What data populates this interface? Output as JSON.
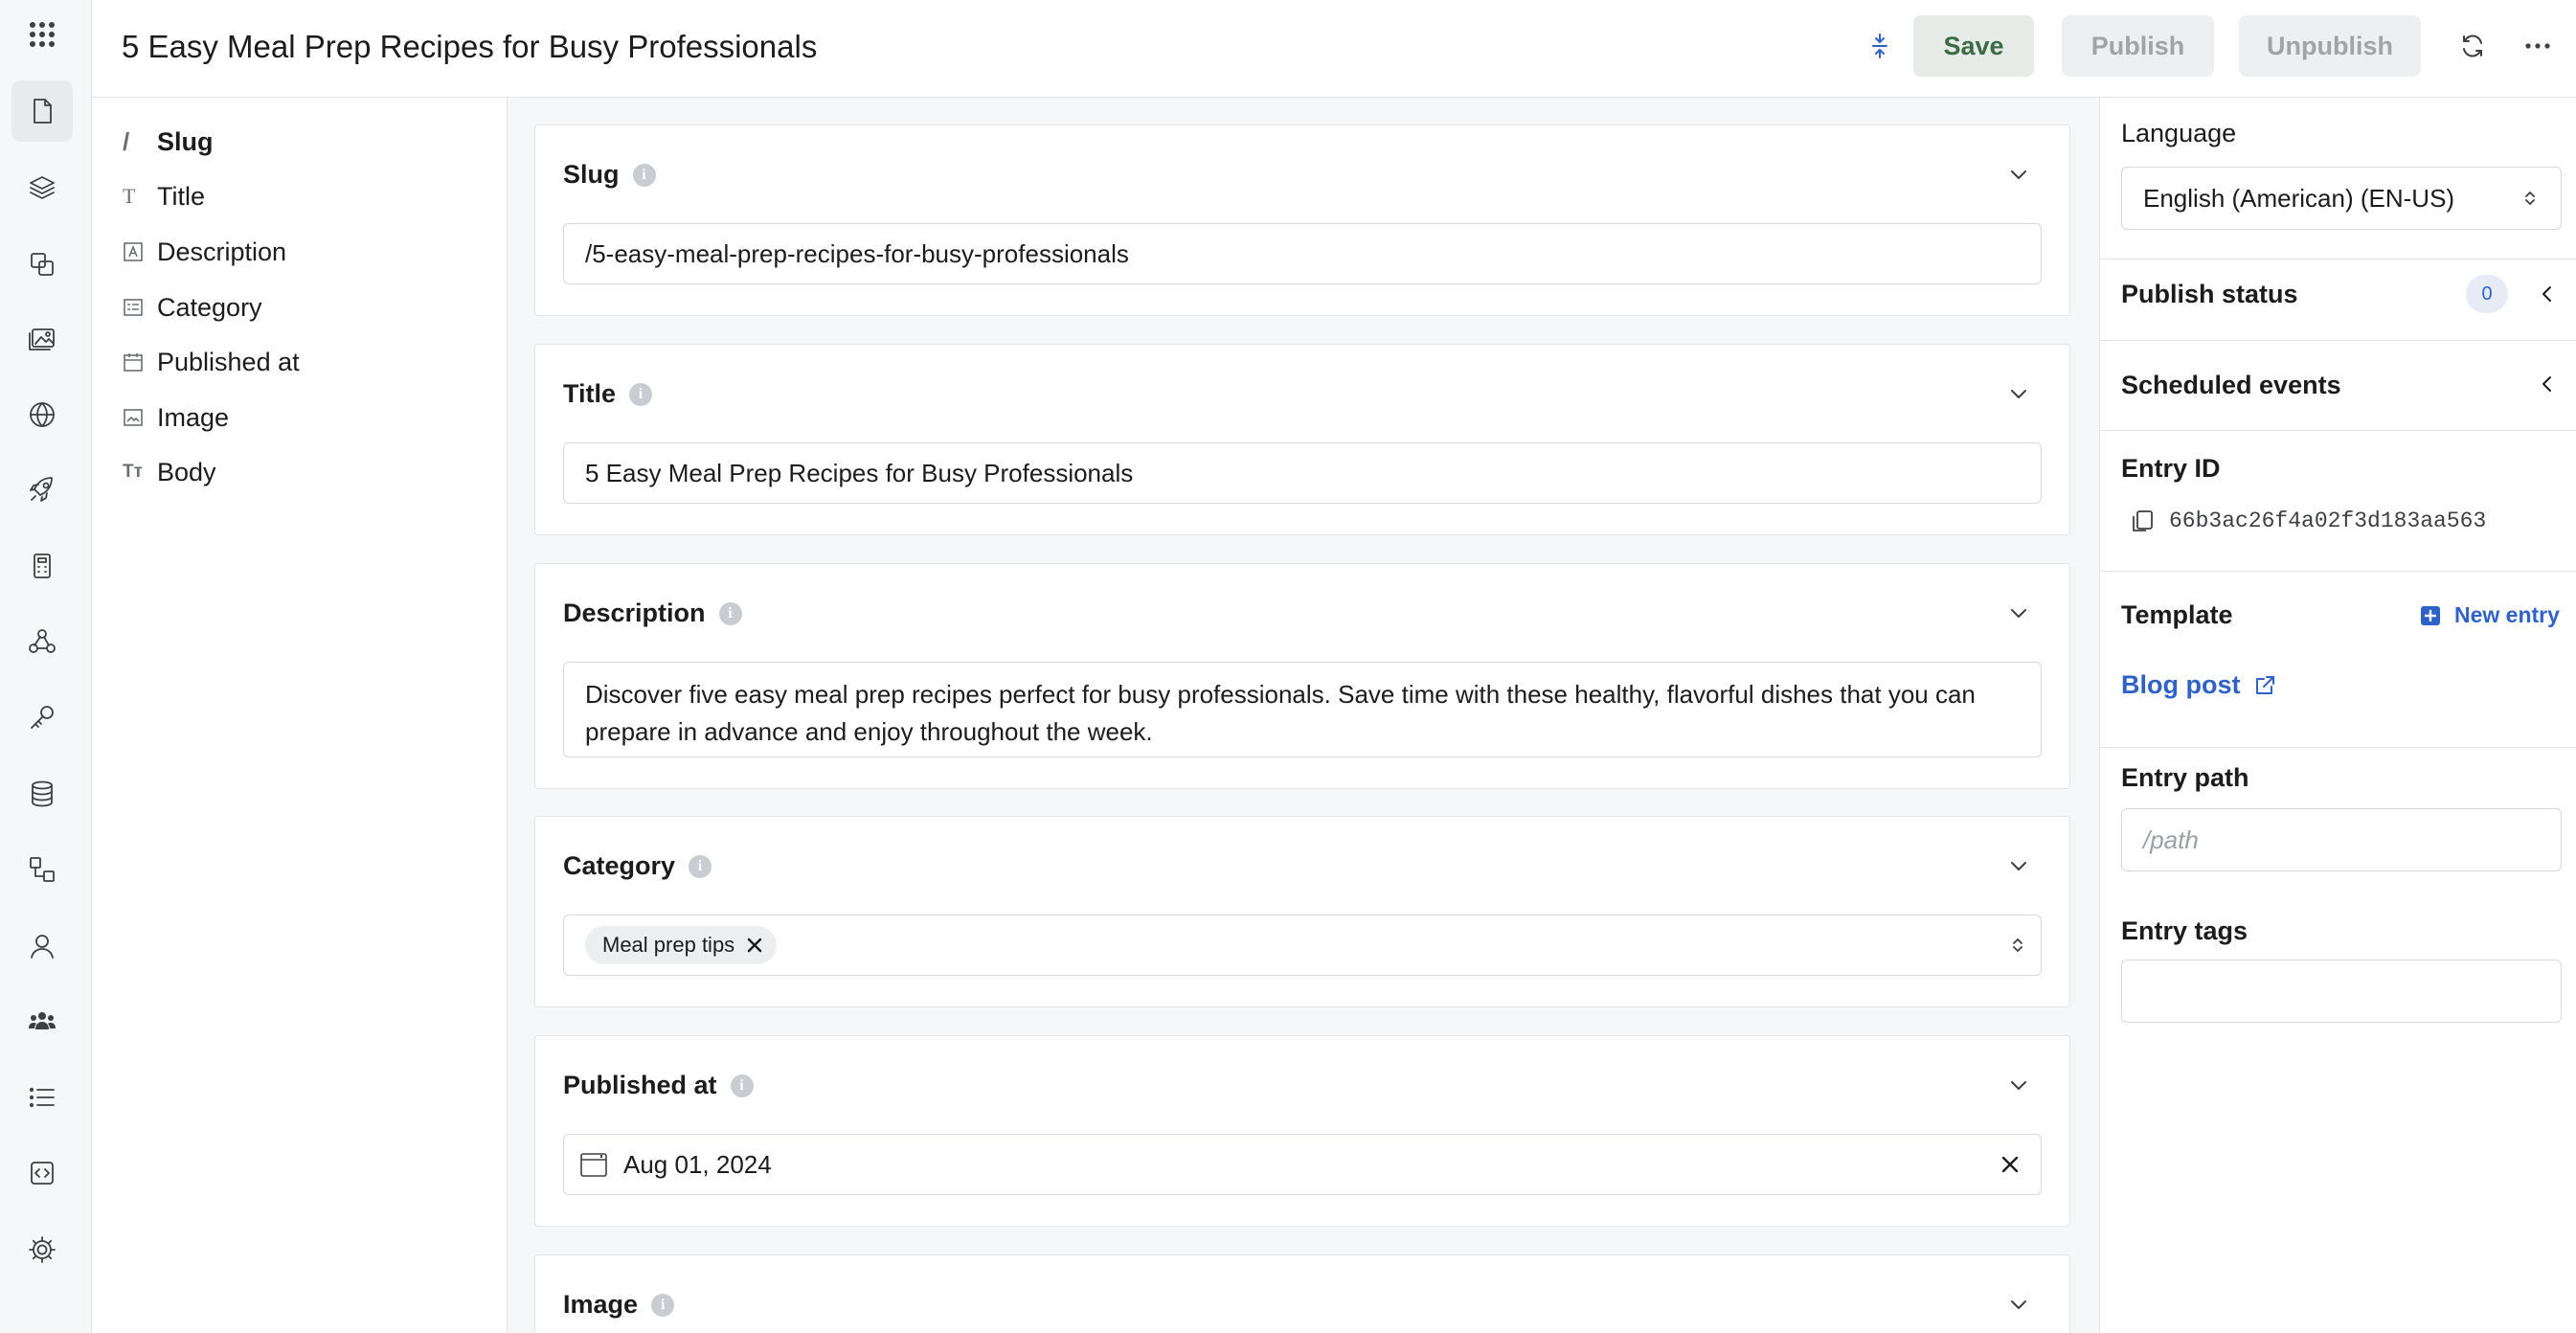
{
  "header": {
    "title": "5 Easy Meal Prep Recipes for Busy Professionals",
    "save_label": "Save",
    "publish_label": "Publish",
    "unpublish_label": "Unpublish"
  },
  "rail": {
    "items": [
      "apps-grid-icon",
      "pages-icon",
      "layers-icon",
      "components-icon",
      "media-icon",
      "globe-icon",
      "rocket-icon",
      "calculator-icon",
      "webhooks-icon",
      "key-icon",
      "database-icon",
      "workflow-icon",
      "user-icon",
      "team-icon",
      "list-icon",
      "code-icon",
      "gear-icon"
    ]
  },
  "fieldnav": {
    "items": [
      {
        "icon": "/",
        "label": "Slug"
      },
      {
        "icon": "T",
        "label": "Title"
      },
      {
        "icon": "A",
        "label": "Description"
      },
      {
        "icon": "cat",
        "label": "Category"
      },
      {
        "icon": "cal",
        "label": "Published at"
      },
      {
        "icon": "img",
        "label": "Image"
      },
      {
        "icon": "Tт",
        "label": "Body"
      }
    ]
  },
  "fields": {
    "slug": {
      "label": "Slug",
      "value": "/5-easy-meal-prep-recipes-for-busy-professionals"
    },
    "title": {
      "label": "Title",
      "value": "5 Easy Meal Prep Recipes for Busy Professionals"
    },
    "description": {
      "label": "Description",
      "value": "Discover five easy meal prep recipes perfect for busy professionals. Save time with these healthy, flavorful dishes that you can prepare in advance and enjoy throughout the week."
    },
    "category": {
      "label": "Category",
      "chip": "Meal prep tips"
    },
    "published_at": {
      "label": "Published at",
      "value": "Aug 01, 2024"
    },
    "image": {
      "label": "Image"
    }
  },
  "sidebar": {
    "language_label": "Language",
    "language_value": "English (American) (EN-US)",
    "publish_status_label": "Publish status",
    "publish_status_count": "0",
    "scheduled_events_label": "Scheduled events",
    "entry_id_label": "Entry ID",
    "entry_id_value": "66b3ac26f4a02f3d183aa563",
    "template_label": "Template",
    "new_entry_label": "New entry",
    "template_value": "Blog post",
    "entry_path_label": "Entry path",
    "entry_path_placeholder": "/path",
    "entry_tags_label": "Entry tags"
  },
  "colors": {
    "accent": "#2f62c9",
    "save_bg": "#e6ebe7",
    "save_text": "#3a6b45"
  }
}
